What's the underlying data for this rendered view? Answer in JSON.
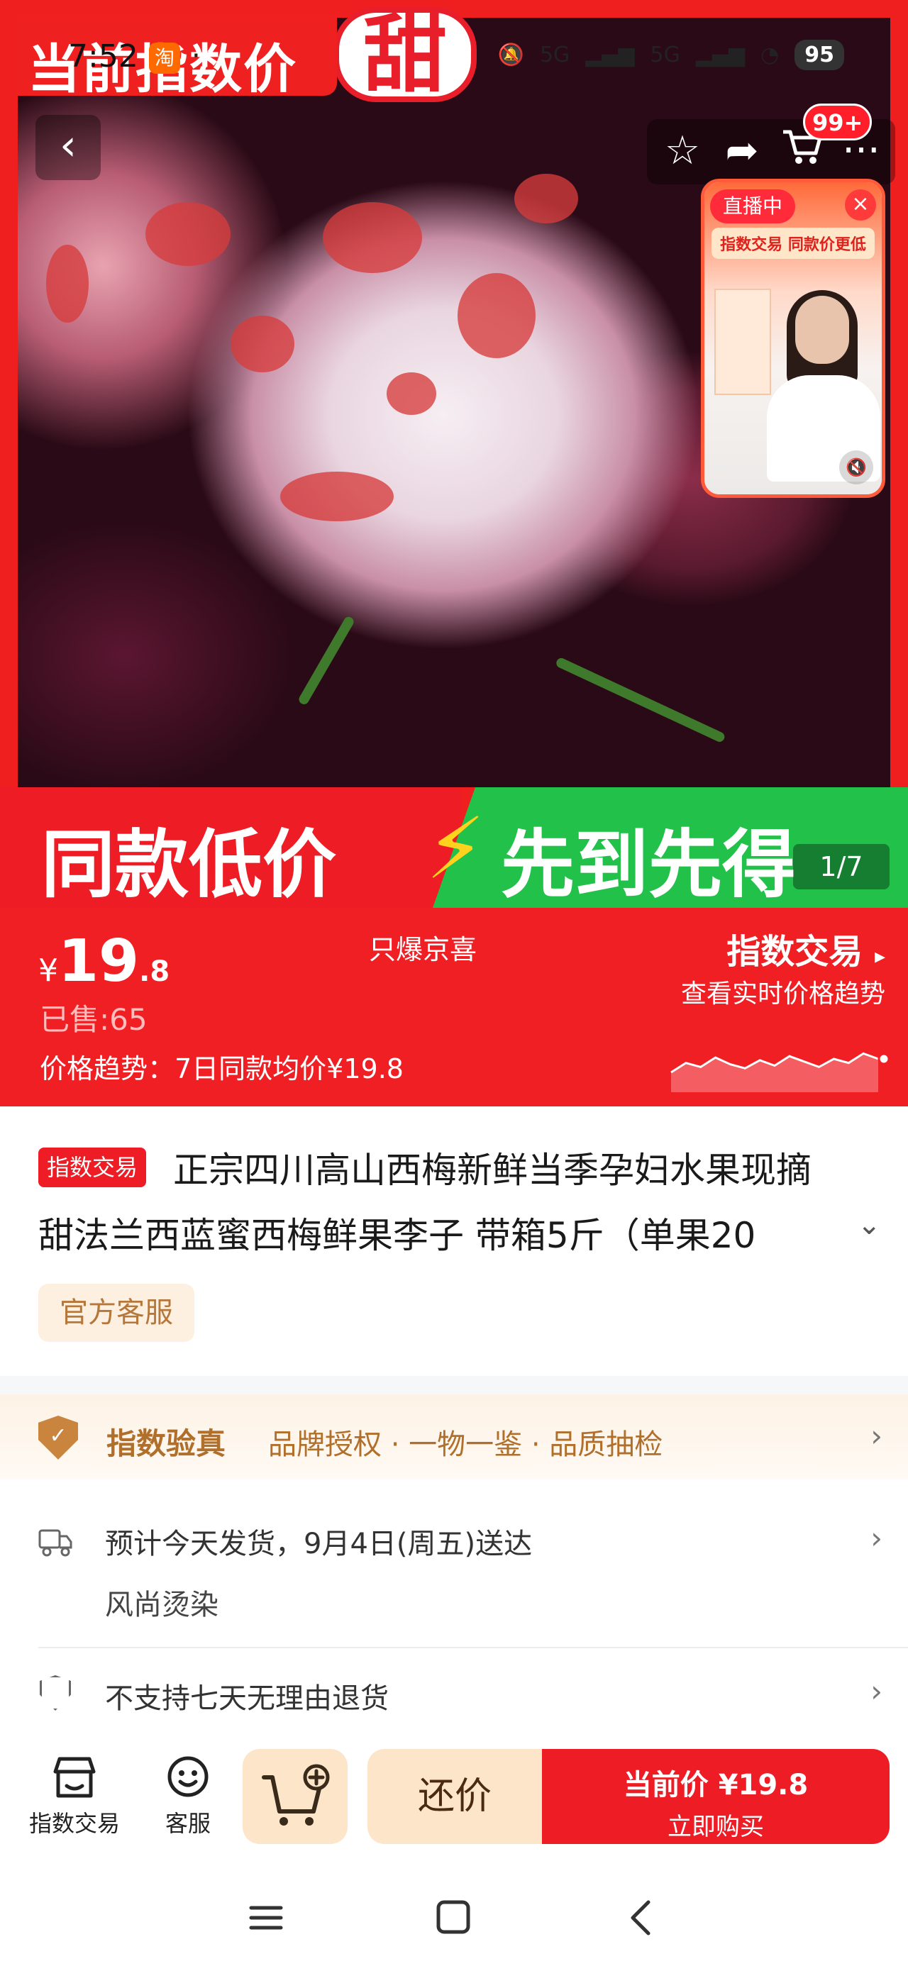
{
  "status_bar": {
    "time": "7:52",
    "app_badge": "淘",
    "network1": "5G",
    "network2": "5G",
    "battery": "95"
  },
  "hero": {
    "top_banner": "当前指数价",
    "big_text": "甜",
    "bottom_left": "同款低价",
    "bottom_right": "先到先得",
    "counter": "1/7",
    "cart_badge": "99+"
  },
  "live": {
    "badge": "直播中",
    "caption": "指数交易 同款价更低",
    "close": "×"
  },
  "price": {
    "currency": "¥",
    "integer": "19",
    "decimal": ".8",
    "sold": "已售:65",
    "trend": "价格趋势：7日同款均价¥19.8",
    "brand_tag": "只爆京喜",
    "index_trade": "指数交易",
    "index_sub": "查看实时价格趋势",
    "accent": "#f01f24"
  },
  "product": {
    "badge": "指数交易",
    "title_line1": "正宗四川高山西梅新鲜当季孕妇水果现摘",
    "title_line2": "甜法兰西蓝蜜西梅鲜果李子 带箱5斤（单果20",
    "service_chip": "官方客服"
  },
  "verify": {
    "title": "指数验真",
    "desc": "品牌授权 · 一物一鉴 · 品质抽检"
  },
  "delivery": {
    "text": "预计今天发货，9月4日(周五)送达",
    "sub": "风尚烫染"
  },
  "returns": {
    "text": "不支持七天无理由退货"
  },
  "action_bar": {
    "shop_label": "指数交易",
    "service_label": "客服",
    "bargain": "还价",
    "buy_price": "当前价 ¥19.8",
    "buy_label": "立即购买"
  },
  "chart_data": {
    "type": "line",
    "title": "",
    "series": [
      {
        "values": [
          0.0,
          0.35,
          0.2,
          0.55,
          0.3,
          0.15,
          0.45,
          0.25,
          0.6,
          0.4,
          0.2,
          0.5,
          0.35,
          0.7,
          0.5
        ]
      }
    ]
  }
}
